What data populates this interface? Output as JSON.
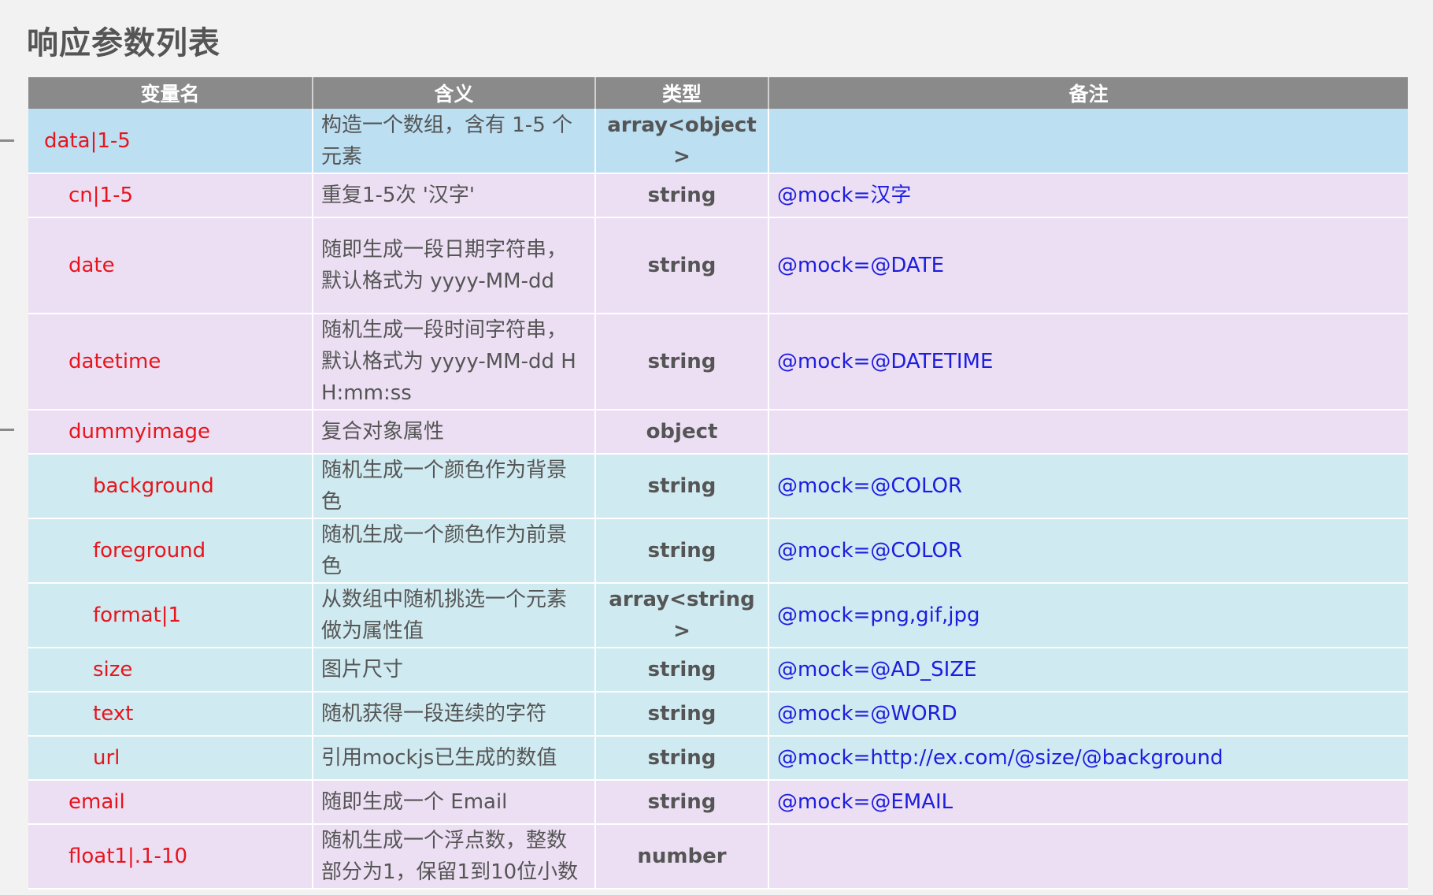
{
  "page": {
    "title": "响应参数列表"
  },
  "table": {
    "headers": [
      "变量名",
      "含义",
      "类型",
      "备注"
    ],
    "rows": [
      {
        "name": "data|1-5",
        "meaning": "构造一个数组，含有 1-5 个元素",
        "type": "array<object>",
        "note": "",
        "level": 0,
        "color": "#bcdff2"
      },
      {
        "name": "cn|1-5",
        "meaning": "重复1-5次 '汉字'",
        "type": "string",
        "note": "@mock=汉字",
        "level": 1,
        "color": "#ecdff3"
      },
      {
        "name": "date",
        "meaning": "随即生成一段日期字符串，默认格式为 yyyy-MM-dd",
        "type": "string",
        "note": "@mock=@DATE",
        "level": 1,
        "color": "#ecdff3"
      },
      {
        "name": "datetime",
        "meaning": "随机生成一段时间字符串，默认格式为 yyyy-MM-dd HH:mm:ss",
        "type": "string",
        "note": "@mock=@DATETIME",
        "level": 1,
        "color": "#ecdff3"
      },
      {
        "name": "dummyimage",
        "meaning": "复合对象属性",
        "type": "object",
        "note": "",
        "level": 1,
        "color": "#ecdff3"
      },
      {
        "name": "background",
        "meaning": "随机生成一个颜色作为背景色",
        "type": "string",
        "note": "@mock=@COLOR",
        "level": 2,
        "color": "#cfeaf0"
      },
      {
        "name": "foreground",
        "meaning": "随机生成一个颜色作为前景色",
        "type": "string",
        "note": "@mock=@COLOR",
        "level": 2,
        "color": "#cfeaf0"
      },
      {
        "name": "format|1",
        "meaning": "从数组中随机挑选一个元素做为属性值",
        "type": "array<string>",
        "note": "@mock=png,gif,jpg",
        "level": 2,
        "color": "#cfeaf0"
      },
      {
        "name": "size",
        "meaning": "图片尺寸",
        "type": "string",
        "note": "@mock=@AD_SIZE",
        "level": 2,
        "color": "#cfeaf0"
      },
      {
        "name": "text",
        "meaning": "随机获得一段连续的字符",
        "type": "string",
        "note": "@mock=@WORD",
        "level": 2,
        "color": "#cfeaf0"
      },
      {
        "name": "url",
        "meaning": "引用mockjs已生成的数值",
        "type": "string",
        "note": "@mock=http://ex.com/@size/@background",
        "level": 2,
        "color": "#cfeaf0"
      },
      {
        "name": "email",
        "meaning": "随即生成一个 Email",
        "type": "string",
        "note": "@mock=@EMAIL",
        "level": 1,
        "color": "#ecdff3"
      },
      {
        "name": "float1|.1-10",
        "meaning": "随机生成一个浮点数，整数部分为1，保留1到10位小数",
        "type": "number",
        "note": "",
        "level": 1,
        "color": "#ecdff3"
      }
    ]
  },
  "colors": {
    "header_bg": "#8a8a8a",
    "name_text": "#e8141c",
    "note_text": "#1d1de0",
    "plain_text": "#555555"
  }
}
